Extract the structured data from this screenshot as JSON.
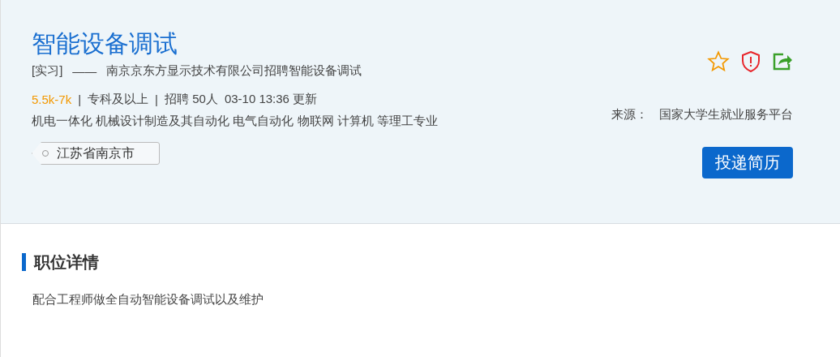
{
  "job": {
    "title": "智能设备调试",
    "type": "[实习]",
    "dash": "——",
    "company": "南京京东方显示技术有限公司招聘智能设备调试",
    "salary": "5.5k-7k",
    "separator": "|",
    "education": "专科及以上",
    "headcount": "招聘 50人",
    "updated": "03-10 13:36 更新",
    "majors": "机电一体化 机械设计制造及其自动化 电气自动化 物联网 计算机 等理工专业",
    "location": "江苏省南京市",
    "source_label": "来源：",
    "source": "国家大学生就业服务平台",
    "apply_button": "投递简历"
  },
  "details": {
    "heading": "职位详情",
    "description": "配合工程师做全自动智能设备调试以及维护"
  }
}
